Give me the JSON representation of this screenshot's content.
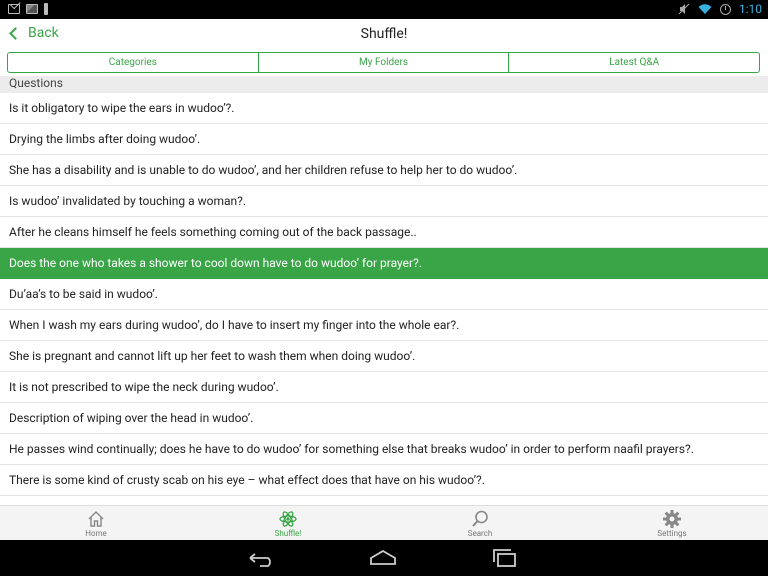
{
  "status_bar": {
    "time": "1:10",
    "left_icons": [
      "mail-icon",
      "picture-icon",
      "usb-icon"
    ],
    "right_icons": [
      "mute-icon",
      "wifi-icon",
      "alarm-icon"
    ]
  },
  "action_bar": {
    "back_label": "Back",
    "title": "Shuffle!"
  },
  "tabs": [
    {
      "label": "Categories"
    },
    {
      "label": "My Folders"
    },
    {
      "label": "Latest Q&A"
    }
  ],
  "section_header": "Questions",
  "questions": [
    {
      "text": "Is it obligatory to wipe the ears in wudoo’?."
    },
    {
      "text": "Drying the limbs after doing wudoo’."
    },
    {
      "text": "She has a disability and is unable to do wudoo’, and her children refuse to help her to do wudoo’."
    },
    {
      "text": "Is wudoo’ invalidated by touching a woman?."
    },
    {
      "text": "After he cleans himself he feels something coming out of the back passage.."
    },
    {
      "text": "Does the one who takes a shower to cool down have to do wudoo’ for prayer?."
    },
    {
      "text": "Du’aa’s to be said in wudoo’."
    },
    {
      "text": "When I wash my ears during wudoo’, do I have to insert my finger into the whole ear?."
    },
    {
      "text": "She is pregnant and cannot lift up her feet to wash them when doing wudoo’."
    },
    {
      "text": "It is not prescribed to wipe the neck during wudoo’."
    },
    {
      "text": "Description of wiping over the head in wudoo’."
    },
    {
      "text": "He passes wind continually; does he have to do wudoo’ for something else that breaks wudoo’ in order to perform naafil prayers?."
    },
    {
      "text": "There is some kind of crusty scab on his eye – what effect does that have on his wudoo’?."
    }
  ],
  "selected_index": 5,
  "bottom_nav": [
    {
      "label": "Home",
      "icon": "home-icon"
    },
    {
      "label": "Shuffle!",
      "icon": "shuffle-icon"
    },
    {
      "label": "Search",
      "icon": "search-icon"
    },
    {
      "label": "Settings",
      "icon": "gear-icon"
    }
  ],
  "colors": {
    "accent": "#3aa547",
    "time": "#38b0de"
  }
}
